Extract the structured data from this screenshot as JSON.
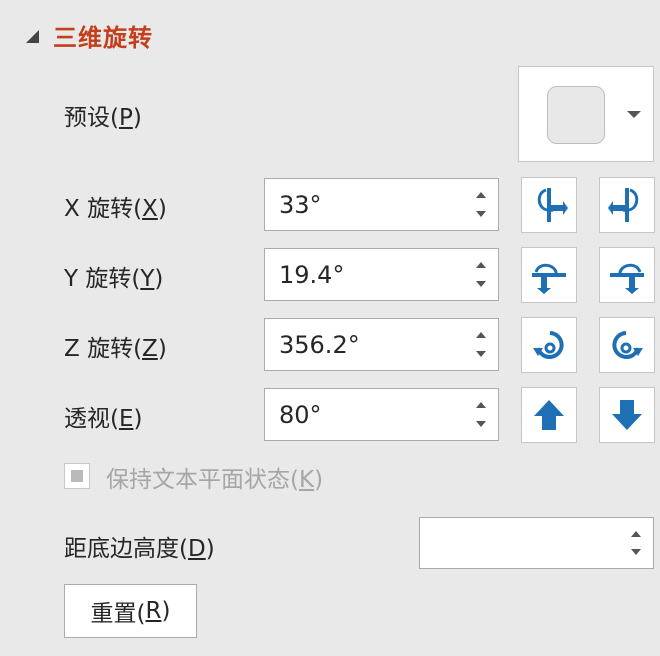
{
  "section": {
    "title": "三维旋转"
  },
  "preset": {
    "label": "预设(",
    "key": "P",
    "suffix": ")"
  },
  "x_rotation": {
    "label": "X 旋转(",
    "key": "X",
    "suffix": ")",
    "value": "33°"
  },
  "y_rotation": {
    "label": "Y 旋转(",
    "key": "Y",
    "suffix": ")",
    "value": "19.4°"
  },
  "z_rotation": {
    "label": "Z 旋转(",
    "key": "Z",
    "suffix": ")",
    "value": "356.2°"
  },
  "perspective": {
    "label": "透视(",
    "key": "E",
    "suffix": ")",
    "value": "80°"
  },
  "keep_text_flat": {
    "label": "保持文本平面状态(",
    "key": "K",
    "suffix": ")",
    "checked": false,
    "disabled": true
  },
  "distance_from_ground": {
    "label": "距底边高度(",
    "key": "D",
    "suffix": ")",
    "value": ""
  },
  "reset": {
    "label": "重置(",
    "key": "R",
    "suffix": ")"
  },
  "colors": {
    "accent": "#c43e1c",
    "icon_blue": "#1f6fb5"
  }
}
